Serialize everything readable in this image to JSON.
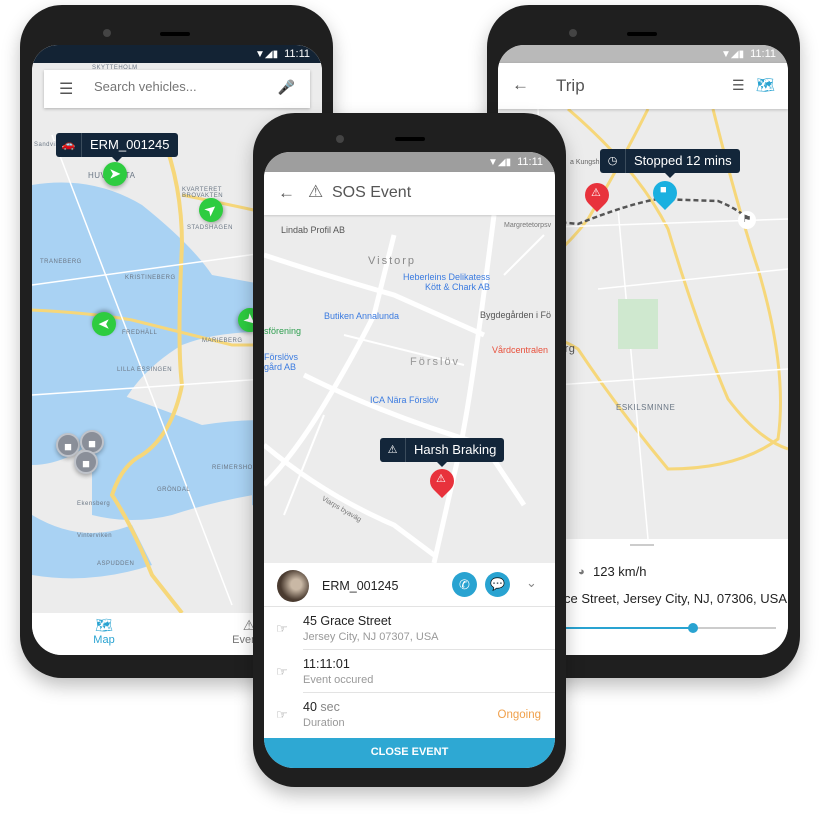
{
  "status_time": "11:11",
  "map_screen": {
    "search_placeholder": "Search vehicles...",
    "vehicle_tooltip": "ERM_001245",
    "place_labels": [
      "SKYTTEHOLM",
      "Sandvik",
      "HUVUDSTA",
      "KVARTERET BROVAKTEN",
      "STADSHAGEN",
      "TRANEBERG",
      "KRISTINEBERG",
      "FREDHÄLL",
      "MARIEBERG",
      "LILLA ESSINGEN",
      "REIMERSHOLME",
      "GRÖNDAL",
      "Ekensberg",
      "Vinterviken",
      "ASPUDDEN"
    ],
    "nav": [
      {
        "label": "Map",
        "icon": "map-icon",
        "active": true
      },
      {
        "label": "Events",
        "icon": "warning-icon",
        "active": false
      }
    ],
    "accent": "#29a3d1",
    "marker_color": "#2ecc40"
  },
  "sos_screen": {
    "title": "SOS Event",
    "place_labels": [
      "Lindab Profil AB",
      "Vistorp",
      "Heberleins Delikatess Kött & Chark AB",
      "Margretetorpsv",
      "Butiken Annalunda",
      "Bygdegården i Fö",
      "Vårdcentralen",
      "Förslöv",
      "ICA Nära Förslöv",
      "sförening",
      "Förslövs gård AB",
      "Viarps byaväg"
    ],
    "event_tooltip": "Harsh Braking",
    "vehicle": "ERM_001245",
    "details": [
      {
        "primary": "45 Grace Street",
        "secondary": "Jersey City, NJ 07307, USA",
        "status": ""
      },
      {
        "primary": "11:11:01",
        "secondary": "Event occured",
        "status": ""
      },
      {
        "primary": "40",
        "unit": "sec",
        "secondary": "Duration",
        "status": "Ongoing"
      }
    ],
    "close_button": "CLOSE EVENT",
    "status_color": "#f0a04b",
    "alert_color": "#e8323c"
  },
  "trip_screen": {
    "title": "Trip",
    "stop_tooltip": "Stopped 12 mins",
    "place_labels": [
      "a Kungsh",
      "ESKILSMINNE",
      "org"
    ],
    "speed": "123 km/h",
    "address": "ce Street, Jersey City, NJ, 07306, USA",
    "progress": 0.7
  }
}
